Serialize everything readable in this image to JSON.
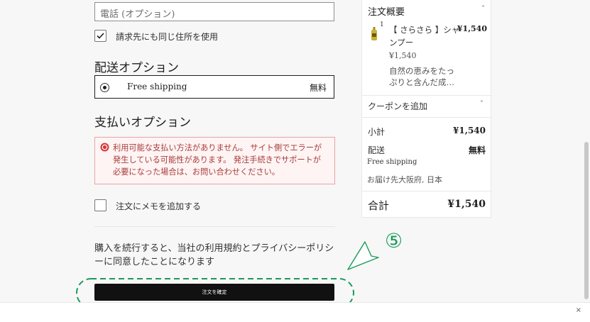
{
  "contact": {
    "phone_placeholder": "電話 (オプション)"
  },
  "billing": {
    "same_address_label": "請求先にも同じ住所を使用",
    "same_address_checked": true
  },
  "shipping": {
    "heading": "配送オプション",
    "option_label": "Free shipping",
    "option_price": "無料"
  },
  "payment": {
    "heading": "支払いオプション",
    "error_lines": [
      "利用可能な支払い方法がありません。 サイト側でエラーが",
      "発生している可能性があります。 発注手続きでサポートが",
      "必要になった場合は、お問い合わせください。"
    ]
  },
  "note": {
    "label": "注文にメモを追加する"
  },
  "terms": {
    "line1": "購入を続行すると、当社の利用規約とプライバシーポリシ",
    "line2": "ーに同意したことになります"
  },
  "place_order": {
    "label": "注文を確定"
  },
  "annotation": {
    "step_number": "⑤",
    "color": "#1a9a5a"
  },
  "summary": {
    "title": "注文概要",
    "item": {
      "quantity": "1",
      "name_line1": "【 さらさら 】シャ",
      "name_line2": "ンプー",
      "price": "¥1,540",
      "unit_price": "¥1,540",
      "desc_line1": "自然の恵みをたっ",
      "desc_line2": "ぷりと含んだ成…"
    },
    "coupon_label": "クーポンを追加",
    "subtotal_label": "小計",
    "subtotal_value": "¥1,540",
    "shipping_label": "配送",
    "shipping_value": "無料",
    "shipping_method": "Free shipping",
    "ship_to": "お届け先大阪府, 日本",
    "total_label": "合計",
    "total_value": "¥1,540"
  },
  "bottom_bar": {
    "close_glyph": "×"
  }
}
